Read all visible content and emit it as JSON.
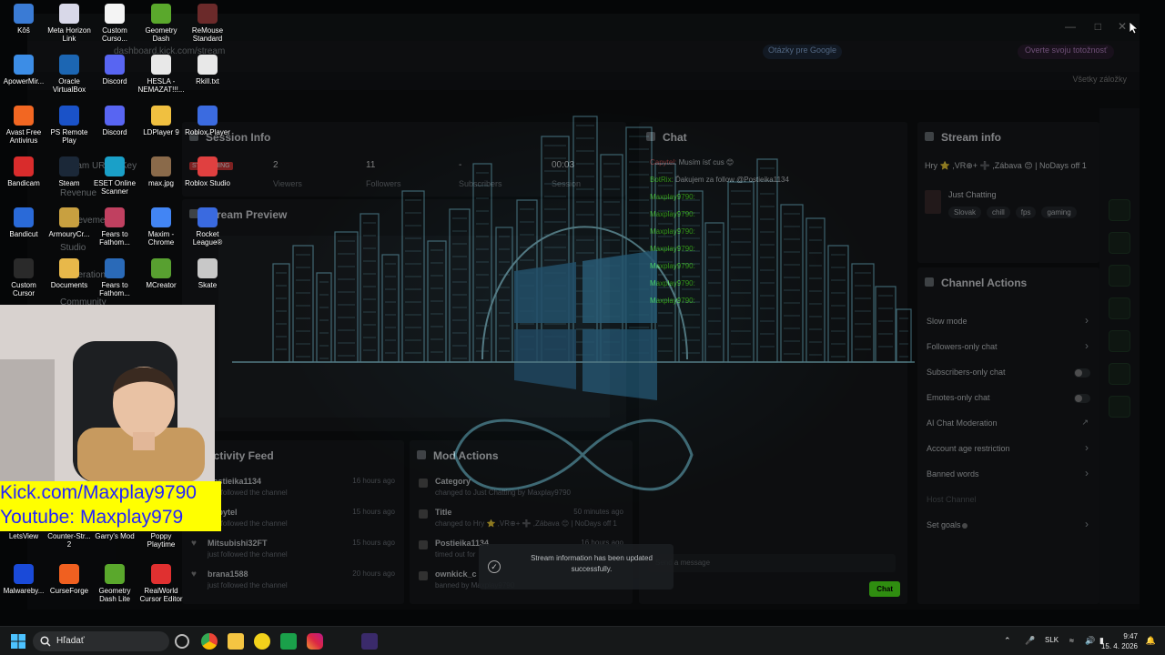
{
  "browser": {
    "url": "dashboard.kick.com/stream",
    "google_chip": "Otázky pre Google",
    "verify_chip": "Overte svoju totožnosť",
    "bookmarks_label": "Všetky záložky"
  },
  "kick": {
    "session_info": {
      "title": "Session Info",
      "live_badge": "STREAMING",
      "stats": [
        {
          "value": "2",
          "label": "Viewers"
        },
        {
          "value": "11",
          "label": "Followers"
        },
        {
          "value": "-",
          "label": "Subscribers"
        },
        {
          "value": "00:03",
          "label": "Session"
        }
      ]
    },
    "stream_preview": {
      "title": "Stream Preview"
    },
    "activity_feed": {
      "title": "Activity Feed",
      "items": [
        {
          "name": "Postieika1134",
          "sub": "just followed the channel",
          "time": "16 hours ago"
        },
        {
          "name": "Capytel",
          "sub": "just followed the channel",
          "time": "15 hours ago"
        },
        {
          "name": "Mitsubishi32FT",
          "sub": "just followed the channel",
          "time": "15 hours ago"
        },
        {
          "name": "brana1588",
          "sub": "just followed the channel",
          "time": "20 hours ago"
        }
      ]
    },
    "mod_actions": {
      "title": "Mod Actions",
      "items": [
        {
          "name": "Category",
          "sub": "changed to Just Chatting by Maxplay9790",
          "time": ""
        },
        {
          "name": "Title",
          "sub": "changed to Hry ⭐ ,VR⊕+ ➕ ,Zábava 😊 | NoDays off 1 by Maxplay9790",
          "time": "50 minutes ago"
        },
        {
          "name": "Postieika1134",
          "sub": "timed out for",
          "time": "16 hours ago"
        },
        {
          "name": "ownkick_c",
          "sub": "banned by Maxplay9790",
          "time": ""
        }
      ]
    },
    "chat": {
      "title": "Chat",
      "lines": [
        {
          "user": "Capytel:",
          "text": "Musím ísť cus 😊"
        },
        {
          "user": "BotRix:",
          "text": "Ďakujem za follow @Postieika1134"
        },
        {
          "user": "Maxplay9790:",
          "text": ""
        },
        {
          "user": "Maxplay9790:",
          "text": ""
        },
        {
          "user": "Maxplay9790:",
          "text": ""
        },
        {
          "user": "Maxplay9790:",
          "text": ""
        },
        {
          "user": "Maxplay9790:",
          "text": ""
        },
        {
          "user": "Maxplay9790:",
          "text": ""
        },
        {
          "user": "Maxplay9790:",
          "text": ""
        }
      ],
      "input_placeholder": "Send a message",
      "send_label": "Chat"
    },
    "stream_info": {
      "title": "Stream info",
      "stream_title": "Hry ⭐ ,VR⊕+ ➕ ,Zábava 😊 | NoDays off 1",
      "category": "Just Chatting",
      "tags": [
        "Slovak",
        "chill",
        "fps",
        "gaming"
      ]
    },
    "channel_actions": {
      "title": "Channel Actions",
      "items": [
        {
          "label": "Slow mode",
          "kind": "chevron"
        },
        {
          "label": "Followers-only chat",
          "kind": "chevron"
        },
        {
          "label": "Subscribers-only chat",
          "kind": "toggle"
        },
        {
          "label": "Emotes-only chat",
          "kind": "toggle"
        },
        {
          "label": "AI Chat Moderation",
          "kind": "external"
        },
        {
          "label": "Account age restriction",
          "kind": "chevron"
        },
        {
          "label": "Banned words",
          "kind": "chevron"
        },
        {
          "label": "Host Channel",
          "kind": "none"
        },
        {
          "label": "Set goals",
          "kind": "chevron"
        }
      ]
    },
    "left_nav": [
      "Stream URL & Key",
      "Revenue",
      "Achievements",
      "Studio",
      "Moderation",
      "Community"
    ],
    "toast": "Stream information has been updated successfully."
  },
  "desktop_icons": [
    {
      "label": "Kôš",
      "color": "#3a7bd5"
    },
    {
      "label": "Meta Horizon Link",
      "color": "#d8d8e8"
    },
    {
      "label": "Custom Curso...",
      "color": "#f4f4f4"
    },
    {
      "label": "Geometry Dash",
      "color": "#5aa82c"
    },
    {
      "label": "ReMouse Standard",
      "color": "#6b2a2a"
    },
    {
      "label": "ApowerMir...",
      "color": "#3c8de6"
    },
    {
      "label": "Oracle VirtualBox",
      "color": "#1c66b3"
    },
    {
      "label": "Discord",
      "color": "#5865f2"
    },
    {
      "label": "HESLA - NEMAZAT!!!...",
      "color": "#e8e8e8"
    },
    {
      "label": "Rkill.txt",
      "color": "#e8e8e8"
    },
    {
      "label": "Avast Free Antivirus",
      "color": "#f26722"
    },
    {
      "label": "PS Remote Play",
      "color": "#1a52c8"
    },
    {
      "label": "Discord",
      "color": "#5865f2"
    },
    {
      "label": "LDPlayer 9",
      "color": "#f0c040"
    },
    {
      "label": "Roblox Player",
      "color": "#3b6be0"
    },
    {
      "label": "Bandicam",
      "color": "#d92c2c"
    },
    {
      "label": "Steam",
      "color": "#1b2838"
    },
    {
      "label": "ESET Online Scanner",
      "color": "#1aa0c8"
    },
    {
      "label": "max.jpg",
      "color": "#8a6a4a"
    },
    {
      "label": "Roblox Studio",
      "color": "#e04040"
    },
    {
      "label": "Bandicut",
      "color": "#2a6ad8"
    },
    {
      "label": "ArmouryCr...",
      "color": "#c8a040"
    },
    {
      "label": "Fears to Fathom...",
      "color": "#c04060"
    },
    {
      "label": "Maxim - Chrome",
      "color": "#4285f4"
    },
    {
      "label": "Rocket League®",
      "color": "#3a6ae0"
    },
    {
      "label": "Custom Cursor",
      "color": "#2a2a2a"
    },
    {
      "label": "Documents",
      "color": "#e8b84a"
    },
    {
      "label": "Fears to Fathom...",
      "color": "#2a6ab8"
    },
    {
      "label": "MCreator",
      "color": "#58a030"
    },
    {
      "label": "Skate",
      "color": "#c8c8c8"
    },
    {
      "label": "LetsView",
      "color": "#2a7ae0"
    },
    {
      "label": "Counter-Str... 2",
      "color": "#d8a030"
    },
    {
      "label": "Garry's Mod",
      "color": "#2a4ab8"
    },
    {
      "label": "Poppy Playtime",
      "color": "#2a3ac8"
    },
    {
      "label": "Malwareby...",
      "color": "#1a4ad8"
    },
    {
      "label": "CurseForge",
      "color": "#f06020"
    },
    {
      "label": "Geometry Dash Lite",
      "color": "#5aa82c"
    },
    {
      "label": "RealWorld Cursor Editor",
      "color": "#e03030"
    }
  ],
  "overlay": {
    "line1": "Kick.com/Maxplay9790",
    "line2": "Youtube: Maxplay979"
  },
  "taskbar": {
    "search_placeholder": "Hľadať",
    "language": "SLK",
    "time": "9:47",
    "date": "15. 4. 2026"
  },
  "colors": {
    "kick_green": "#53fc18",
    "overlay_bg": "#ffff00",
    "overlay_text": "#2323ff",
    "wallpaper_glow": "#5fe3ff"
  }
}
